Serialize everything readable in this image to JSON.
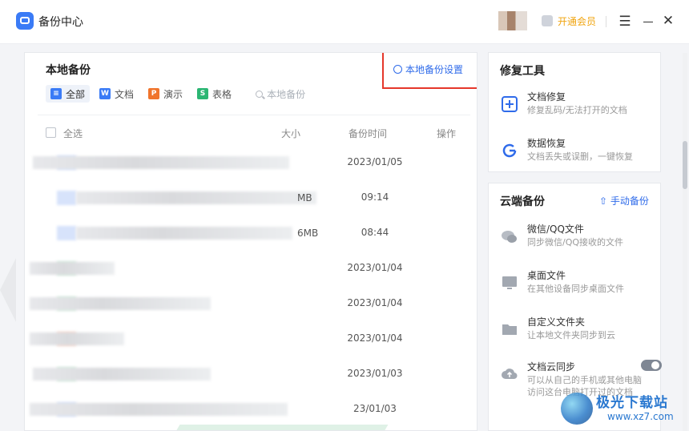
{
  "app": {
    "title": "备份中心",
    "vip_label": "开通会员",
    "menu_icon": "☰",
    "close_icon": "✕"
  },
  "local_backup": {
    "title": "本地备份",
    "settings_label": "本地备份设置",
    "filters": [
      {
        "label": "全部",
        "icon": "list-icon",
        "color": "#3a7bf6"
      },
      {
        "label": "文档",
        "icon": "W",
        "color": "#3a7bf6"
      },
      {
        "label": "演示",
        "icon": "P",
        "color": "#f0742c"
      },
      {
        "label": "表格",
        "icon": "S",
        "color": "#2bb673"
      }
    ],
    "search_placeholder": "本地备份",
    "columns": {
      "select_all": "全选",
      "size": "大小",
      "time": "备份时间",
      "action": "操作"
    },
    "rows": [
      {
        "size": "",
        "time": "2023/01/05"
      },
      {
        "size": "MB",
        "time": "09:14"
      },
      {
        "size": "6MB",
        "time": "08:44"
      },
      {
        "size": "",
        "time": "2023/01/04"
      },
      {
        "size": "",
        "time": "2023/01/04"
      },
      {
        "size": "",
        "time": "2023/01/04"
      },
      {
        "size": "",
        "time": "2023/01/03"
      },
      {
        "size": "",
        "time": "23/01/03"
      }
    ]
  },
  "repair_tools": {
    "title": "修复工具",
    "items": [
      {
        "name": "文档修复",
        "desc": "修复乱码/无法打开的文档"
      },
      {
        "name": "数据恢复",
        "desc": "文档丢失或误删，一键恢复"
      }
    ]
  },
  "cloud_backup": {
    "title": "云端备份",
    "manual_label": "手动备份",
    "items": [
      {
        "name": "微信/QQ文件",
        "desc": "同步微信/QQ接收的文件"
      },
      {
        "name": "桌面文件",
        "desc": "在其他设备同步桌面文件"
      },
      {
        "name": "自定义文件夹",
        "desc": "让本地文件夹同步到云"
      },
      {
        "name": "文档云同步",
        "desc": "可以从自己的手机或其他电脑",
        "desc2": "访问这台电脑打开过的文档",
        "toggle_on": true
      }
    ]
  },
  "watermark": {
    "title": "极光下载站",
    "url": "www.xz7.com"
  }
}
